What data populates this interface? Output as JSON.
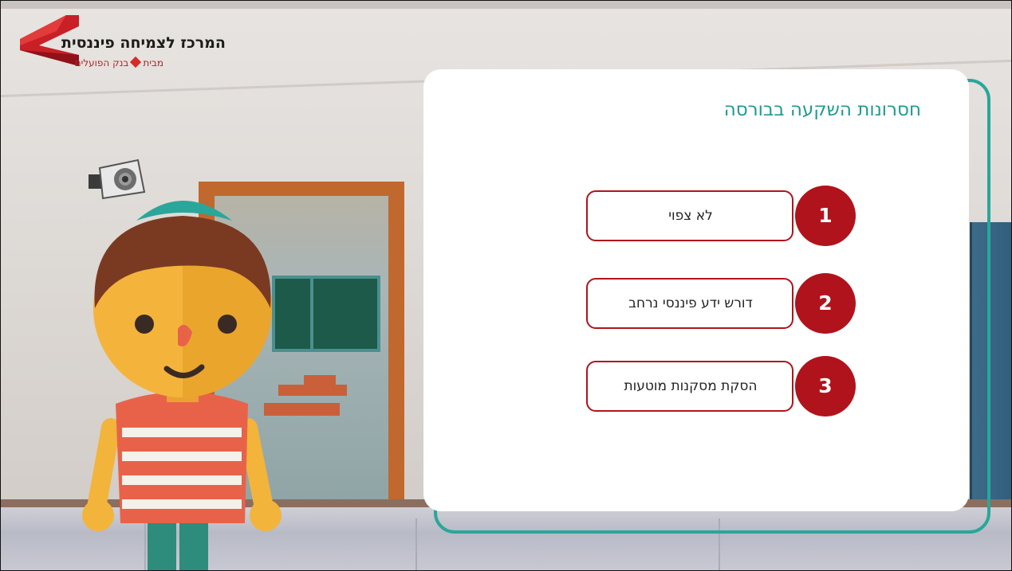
{
  "brand": {
    "title": "המרכז לצמיחה פיננסית",
    "subtitle_before": "מבית",
    "subtitle_after": "בנק הפועלים",
    "colors": {
      "red": "#d62b2b",
      "dark": "#1c1c1c"
    }
  },
  "panel": {
    "title": "חסרונות השקעה בבורסה",
    "items": [
      {
        "number": "1",
        "label": "לא צפוי"
      },
      {
        "number": "2",
        "label": "דורש ידע פיננסי נרחב"
      },
      {
        "number": "3",
        "label": "הסקת מסקנות מוטעות"
      }
    ],
    "colors": {
      "accent": "#b1131c",
      "title": "#1f9b8f",
      "border": "#2aa69a"
    }
  }
}
